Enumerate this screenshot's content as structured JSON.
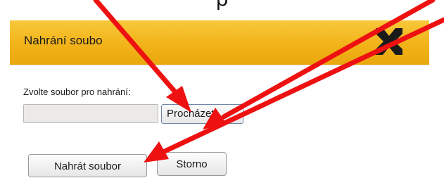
{
  "heading_partial": "p",
  "dialog": {
    "title": "Nahrání soubo",
    "header_color": "#f2b319",
    "close_icon": "x-close-icon"
  },
  "form": {
    "file_label": "Zvolte soubor pro nahrání:",
    "file_path_value": "",
    "browse_label": "Procházet"
  },
  "actions": {
    "upload_label": "Nahrát soubor",
    "cancel_label": "Storno"
  },
  "annotation": {
    "arrow_color": "#ee1111"
  }
}
